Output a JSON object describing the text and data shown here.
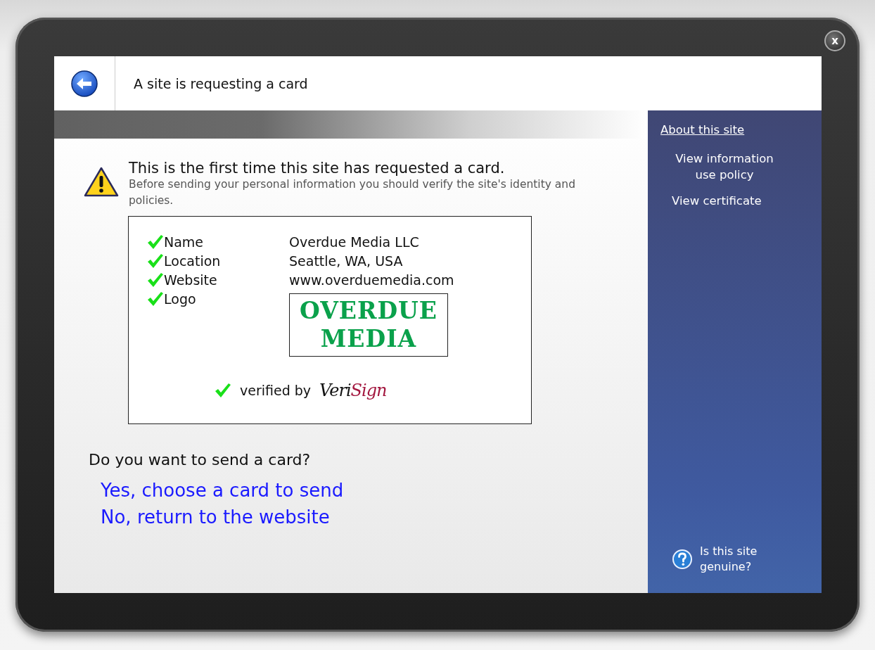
{
  "close_button": "x",
  "header": {
    "title": "A site is requesting a card"
  },
  "warning": {
    "title": "This is the first time this site has requested a card.",
    "text": "Before sending your personal information you should verify the site's identity and policies."
  },
  "details": [
    {
      "label": "Name",
      "checked": true,
      "kind": "text",
      "value": "Overdue Media LLC"
    },
    {
      "label": "Location",
      "checked": true,
      "kind": "text",
      "value": "Seattle, WA, USA"
    },
    {
      "label": "Website",
      "checked": true,
      "kind": "text",
      "value": "www.overduemedia.com"
    },
    {
      "label": "Logo",
      "checked": true,
      "kind": "logo",
      "value": "OVERDUE MEDIA"
    }
  ],
  "verified": {
    "checked": true,
    "text": "verified by",
    "logo_parts": [
      {
        "text": "Veri",
        "color": "#111111"
      },
      {
        "text": "Sign",
        "color": "#a3173f"
      }
    ]
  },
  "question": "Do you want to send a card?",
  "actions": [
    "Yes, choose a card to send",
    "No, return to the website"
  ],
  "sidebar": {
    "heading": "About this site",
    "links": [
      "View information use policy",
      "View certificate"
    ],
    "help": "Is this site genuine?"
  }
}
